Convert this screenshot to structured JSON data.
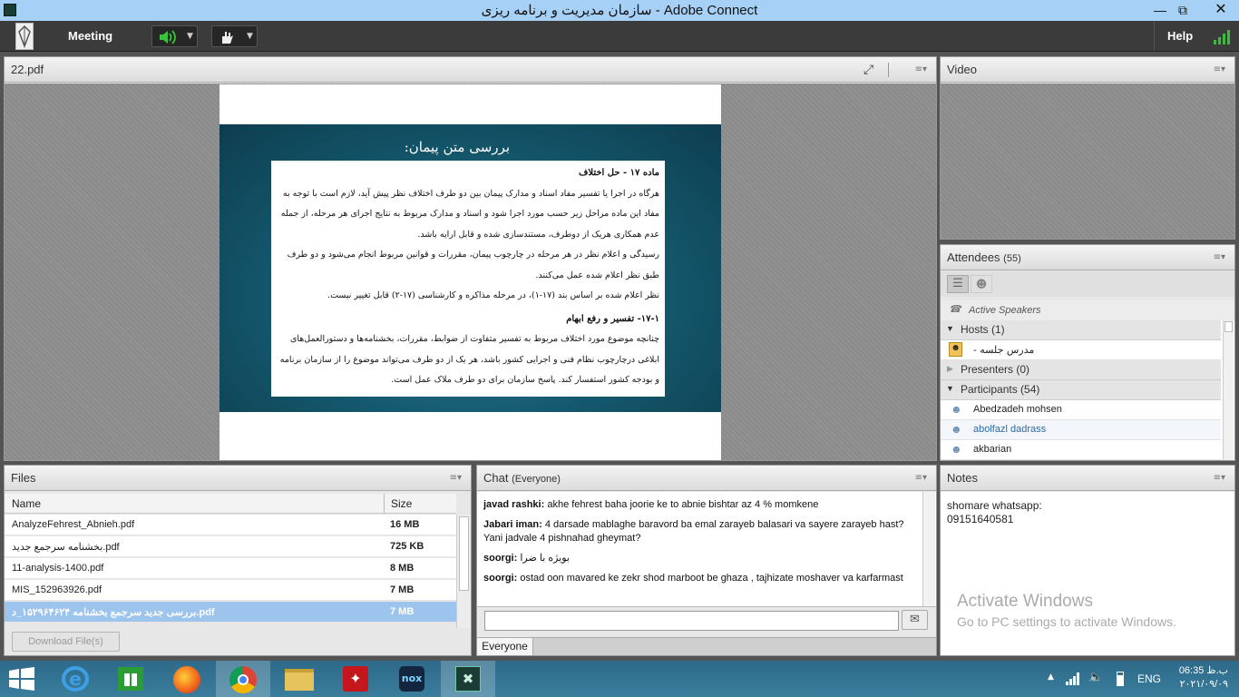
{
  "window": {
    "title": "سازمان مدیریت و برنامه ریزی - Adobe Connect",
    "controls": [
      "minimize",
      "restore",
      "close"
    ]
  },
  "menubar": {
    "meeting_label": "Meeting",
    "help_label": "Help"
  },
  "share_pod": {
    "title": "22.pdf",
    "slide": {
      "heading": "بررسی متن پیمان:",
      "section1": "ماده ۱۷ - حل اختلاف",
      "para1": "هرگاه در اجرا یا تفسیر مفاد اسناد و مدارک پیمان بین دو طرف اختلاف نظر پیش آید، لازم است با توجه به مفاد این ماده مراحل زیر حسب مورد اجرا شود و اسناد و مدارک مربوط به نتایج اجرای هر مرحله، از جمله عدم همکاری هریک از دوطرف، مستندسازی شده و قابل ارایه باشد.",
      "para2": "رسیدگی و اعلام نظر در هر مرحله در چارچوب پیمان، مقررات و قوانین مربوط انجام می‌شود و دو طرف طبق نظر اعلام شده عمل می‌کنند.",
      "para3": "نظر اعلام شده بر اساس بند (۱۷-۱)، در مرحله مذاکره و کارشناسی (۱۷-۲) قابل تغییر نیست.",
      "section2": "۱۷-۱- تفسیر و رفع ابهام",
      "para4": "چنانچه موضوع مورد اختلاف مربوط به تفسیر متفاوت از ضوابط، مقررات، بخشنامه‌ها و دستورالعمل‌های ابلاغی درچارچوب نظام فنی و اجرایی کشور باشد، هر یک از دو طرف می‌تواند موضوع را از سازمان برنامه و بودجه کشور استفسار کند. پاسخ سازمان برای دو طرف ملاک عمل است."
    }
  },
  "video_pod": {
    "title": "Video"
  },
  "attendees_pod": {
    "title": "Attendees",
    "count": "(55)",
    "active_speakers": "Active Speakers",
    "hosts_label": "Hosts (1)",
    "host_name": "مدرس جلسه -",
    "presenters_label": "Presenters (0)",
    "participants_label": "Participants (54)",
    "participants": [
      "Abedzadeh mohsen",
      "abolfazl dadrass",
      "akbarian"
    ]
  },
  "files_pod": {
    "title": "Files",
    "col_name": "Name",
    "col_size": "Size",
    "rows": [
      {
        "name": "AnalyzeFehrest_Abnieh.pdf",
        "size": "16 MB"
      },
      {
        "name": "بخشنامه سرجمع جدید.pdf",
        "size": "725 KB"
      },
      {
        "name": "11-analysis-1400.pdf",
        "size": "8 MB"
      },
      {
        "name": "MIS_152963926.pdf",
        "size": "7 MB"
      },
      {
        "name": "بررسی جدید سرجمع بخشنامه ۱۵۲۹۶۴۶۲۴_د.pdf",
        "size": "7 MB"
      }
    ],
    "download_label": "Download File(s)"
  },
  "chat_pod": {
    "title": "Chat",
    "scope": "(Everyone)",
    "messages": [
      {
        "sender": "javad rashki:",
        "text": "akhe fehrest baha joorie ke  to abnie bishtar az 4 % momkene"
      },
      {
        "sender": "Jabari iman:",
        "text": "4 darsade mablaghe baravord ba emal zarayeb balasari va sayere zarayeb hast? Yani jadvale 4 pishnahad gheymat?"
      },
      {
        "sender": "soorgi:",
        "text": "بویژه با ضرا"
      },
      {
        "sender": "soorgi:",
        "text": "ostad oon mavared ke zekr shod marboot be ghaza , tajhizate moshaver va karfarmast"
      }
    ],
    "input_placeholder": "",
    "tab_everyone": "Everyone"
  },
  "notes_pod": {
    "title": "Notes",
    "line1": "shomare whatsapp:",
    "line2": "09151640581"
  },
  "watermark": {
    "line1": "Activate Windows",
    "line2": "Go to PC settings to activate Windows."
  },
  "taskbar": {
    "language": "ENG",
    "time": "06:35 ب.ظ",
    "date": "۲۰۲۱/۰۹/۰۹",
    "apps": [
      "ie-icon",
      "store-icon",
      "firefox-icon",
      "chrome-icon",
      "explorer-icon",
      "acrobat-icon",
      "nox-icon",
      "adobe-connect-icon"
    ]
  }
}
